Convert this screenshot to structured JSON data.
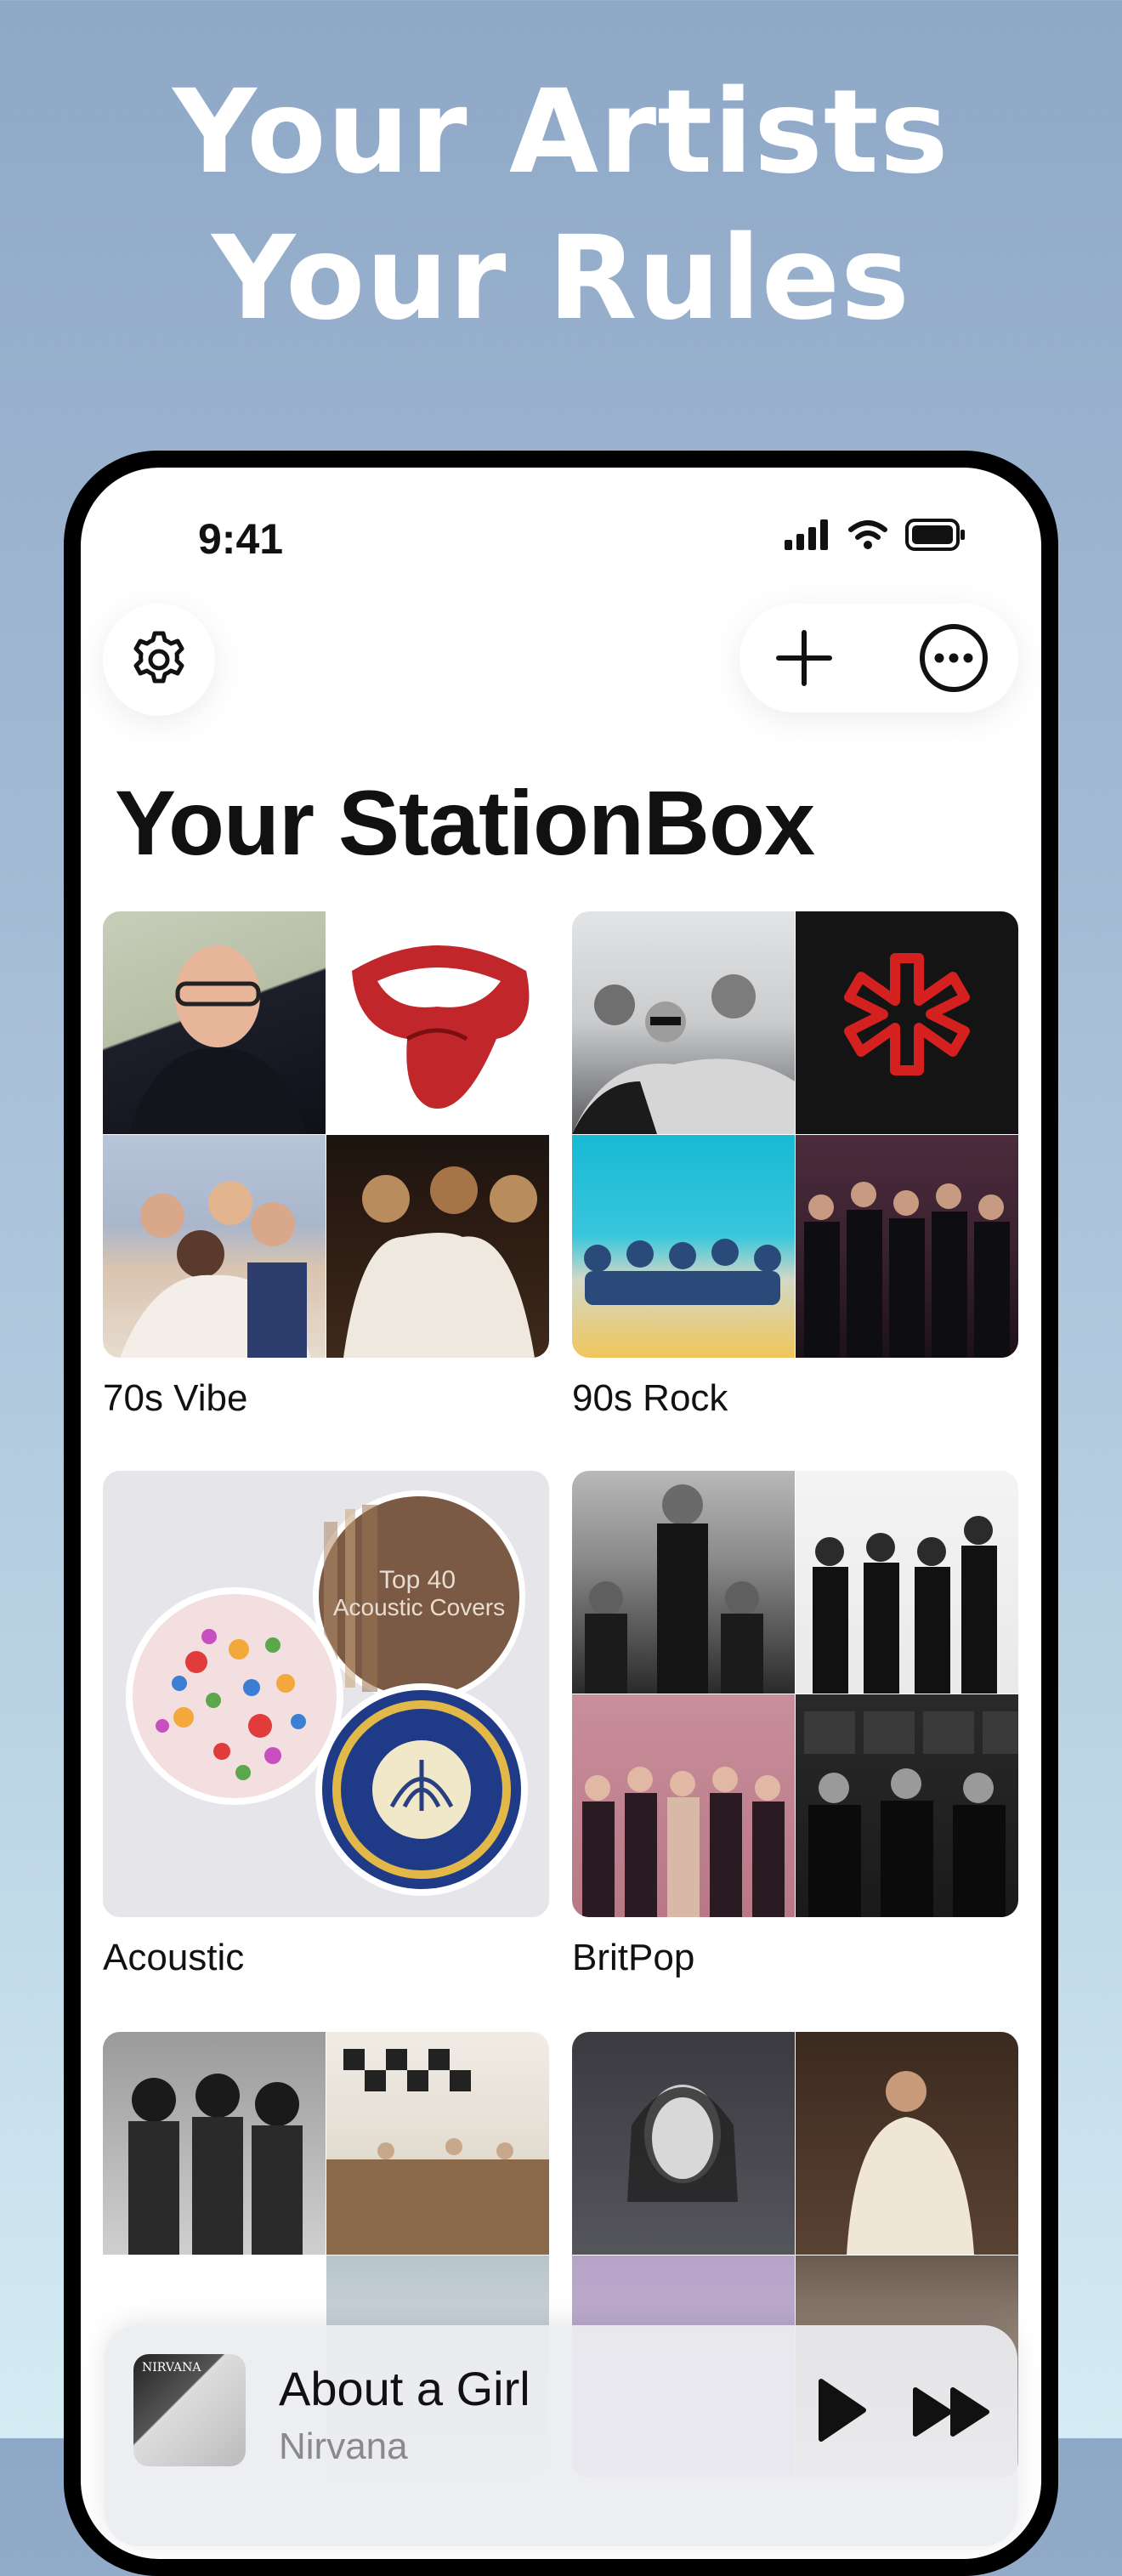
{
  "headline": {
    "line1": "Your Artists",
    "line2": "Your Rules"
  },
  "status_bar": {
    "time": "9:41"
  },
  "toolbar": {
    "settings_icon": "gear-icon",
    "add_icon": "plus-icon",
    "more_icon": "ellipsis-circle-icon"
  },
  "page": {
    "title": "Your StationBox"
  },
  "stations": [
    {
      "label": "70s Vibe"
    },
    {
      "label": "90s Rock"
    },
    {
      "label": "Acoustic",
      "inner_text": {
        "line1": "Top 40",
        "line2": "Acoustic Covers"
      }
    },
    {
      "label": "BritPop"
    },
    {
      "label": ""
    },
    {
      "label": ""
    }
  ],
  "now_playing": {
    "title": "About a Girl",
    "artist": "Nirvana",
    "art_text": "NIRVANA",
    "play_icon": "play-icon",
    "forward_icon": "forward-icon"
  }
}
